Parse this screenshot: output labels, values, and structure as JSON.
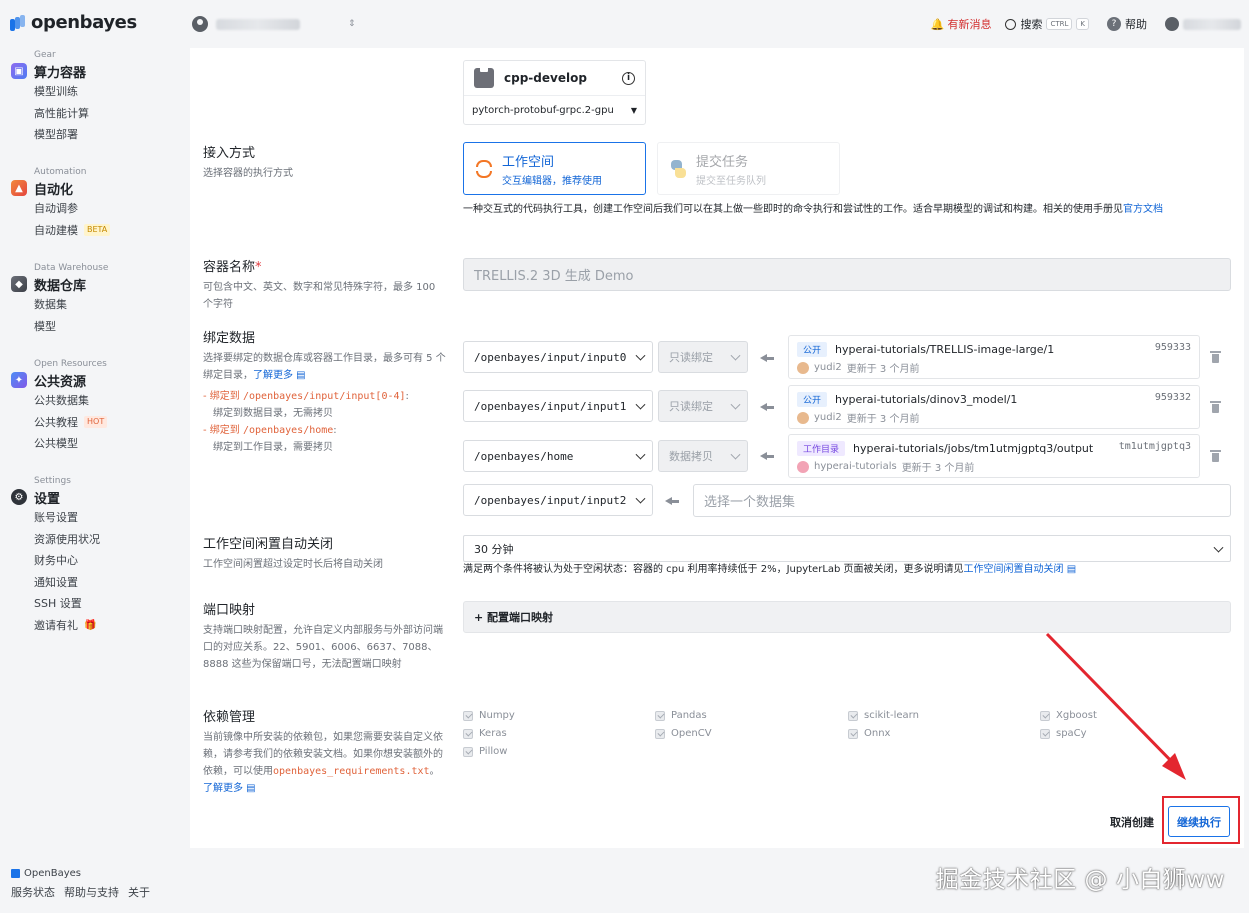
{
  "brand": {
    "logo_text": "openbayes",
    "footer_brand": "OpenBayes"
  },
  "sidebar": {
    "sections": [
      {
        "caption": "Gear",
        "title": "算力容器",
        "icon": "gear-cube-icon",
        "items": [
          "模型训练",
          "高性能计算",
          "模型部署"
        ]
      },
      {
        "caption": "Automation",
        "title": "自动化",
        "icon": "automation-icon",
        "items": [
          "自动调参",
          "自动建模"
        ],
        "badge": "BETA"
      },
      {
        "caption": "Data Warehouse",
        "title": "数据仓库",
        "icon": "database-icon",
        "items": [
          "数据集",
          "模型"
        ]
      },
      {
        "caption": "Open Resources",
        "title": "公共资源",
        "icon": "open-resources-icon",
        "items": [
          "公共数据集",
          "公共教程",
          "公共模型"
        ],
        "badge": "HOT"
      },
      {
        "caption": "Settings",
        "title": "设置",
        "icon": "settings-gear-icon",
        "items": [
          "账号设置",
          "资源使用状况",
          "财务中心",
          "通知设置",
          "SSH 设置",
          "邀请有礼"
        ]
      }
    ],
    "footer_links": [
      "服务状态",
      "帮助与支持",
      "关于"
    ]
  },
  "topbar": {
    "news": "有新消息",
    "search": "搜索",
    "kbd_ctrl": "CTRL",
    "kbd_k": "K",
    "help": "帮助"
  },
  "image": {
    "name": "cpp-develop",
    "version": "pytorch-protobuf-grpc.2-gpu"
  },
  "access": {
    "label": "接入方式",
    "desc": "选择容器的执行方式",
    "modes": [
      {
        "title": "工作空间",
        "sub": "交互编辑器，推荐使用"
      },
      {
        "title": "提交任务",
        "sub": "提交至任务队列"
      }
    ],
    "hint": "一种交互式的代码执行工具，创建工作空间后我们可以在其上做一些即时的命令执行和尝试性的工作。适合早期模型的调试和构建。相关的使用手册见",
    "hint_link": "官方文档"
  },
  "container": {
    "label": "容器名称",
    "required": "*",
    "desc": "可包含中文、英文、数字和常见特殊字符，最多 100 个字符",
    "value": "TRELLIS.2 3D 生成 Demo"
  },
  "binding": {
    "label": "绑定数据",
    "desc": "选择要绑定的数据仓库或容器工作目录，最多可有 5 个绑定目录，",
    "learn_more": "了解更多",
    "note1_prefix": "- 绑定到",
    "note1_path": "/openbayes/input/input[0-4]",
    "note1_suffix": ":",
    "note1_desc": "绑定到数据目录，无需拷贝",
    "note2_prefix": "- 绑定到",
    "note2_path": "/openbayes/home",
    "note2_suffix": ":",
    "note2_desc": "绑定到工作目录，需要拷贝",
    "rows": [
      {
        "path": "/openbayes/input/input0",
        "mode": "只读绑定",
        "badge": "公开",
        "name": "hyperai-tutorials/TRELLIS-image-large/1",
        "id": "959333",
        "user": "yudi2",
        "updated": "更新于 3 个月前"
      },
      {
        "path": "/openbayes/input/input1",
        "mode": "只读绑定",
        "badge": "公开",
        "name": "hyperai-tutorials/dinov3_model/1",
        "id": "959332",
        "user": "yudi2",
        "updated": "更新于 3 个月前"
      },
      {
        "path": "/openbayes/home",
        "mode": "数据拷贝",
        "badge": "工作目录",
        "name": "hyperai-tutorials/jobs/tm1utmjgptq3/output",
        "id": "tm1utmjgptq3",
        "user": "hyperai-tutorials",
        "updated": "更新于 3 个月前"
      }
    ],
    "empty_path": "/openbayes/input/input2",
    "empty_placeholder": "选择一个数据集"
  },
  "idle": {
    "label": "工作空间闲置自动关闭",
    "desc": "工作空间闲置超过设定时长后将自动关闭",
    "value": "30 分钟",
    "hint": "满足两个条件将被认为处于空闲状态：容器的 cpu 利用率持续低于 2%，JupyterLab 页面被关闭，更多说明请见",
    "hint_link": "工作空间闲置自动关闭"
  },
  "port": {
    "label": "端口映射",
    "desc": "支持端口映射配置，允许自定义内部服务与外部访问端口的对应关系。22、5901、6006、6637、7088、8888 这些为保留端口号，无法配置端口映射",
    "button": "+ 配置端口映射"
  },
  "deps": {
    "label": "依赖管理",
    "desc": "当前镜像中所安装的依赖包，如果您需要安装自定义依赖，请参考我们的依赖安装文档。如果你想安装额外的依赖，可以使用",
    "file": "openbayes_requirements.txt",
    "sep": "。",
    "learn_more": "了解更多",
    "items": [
      "Numpy",
      "Pandas",
      "scikit-learn",
      "Xgboost",
      "Keras",
      "OpenCV",
      "Onnx",
      "spaCy",
      "Pillow"
    ]
  },
  "actions": {
    "cancel": "取消创建",
    "continue": "继续执行"
  },
  "watermark": "掘金技术社区 @ 小白狮ww",
  "colors": {
    "accent": "#1a73e8",
    "alert": "#e0393e",
    "annotation": "#e3262f"
  }
}
